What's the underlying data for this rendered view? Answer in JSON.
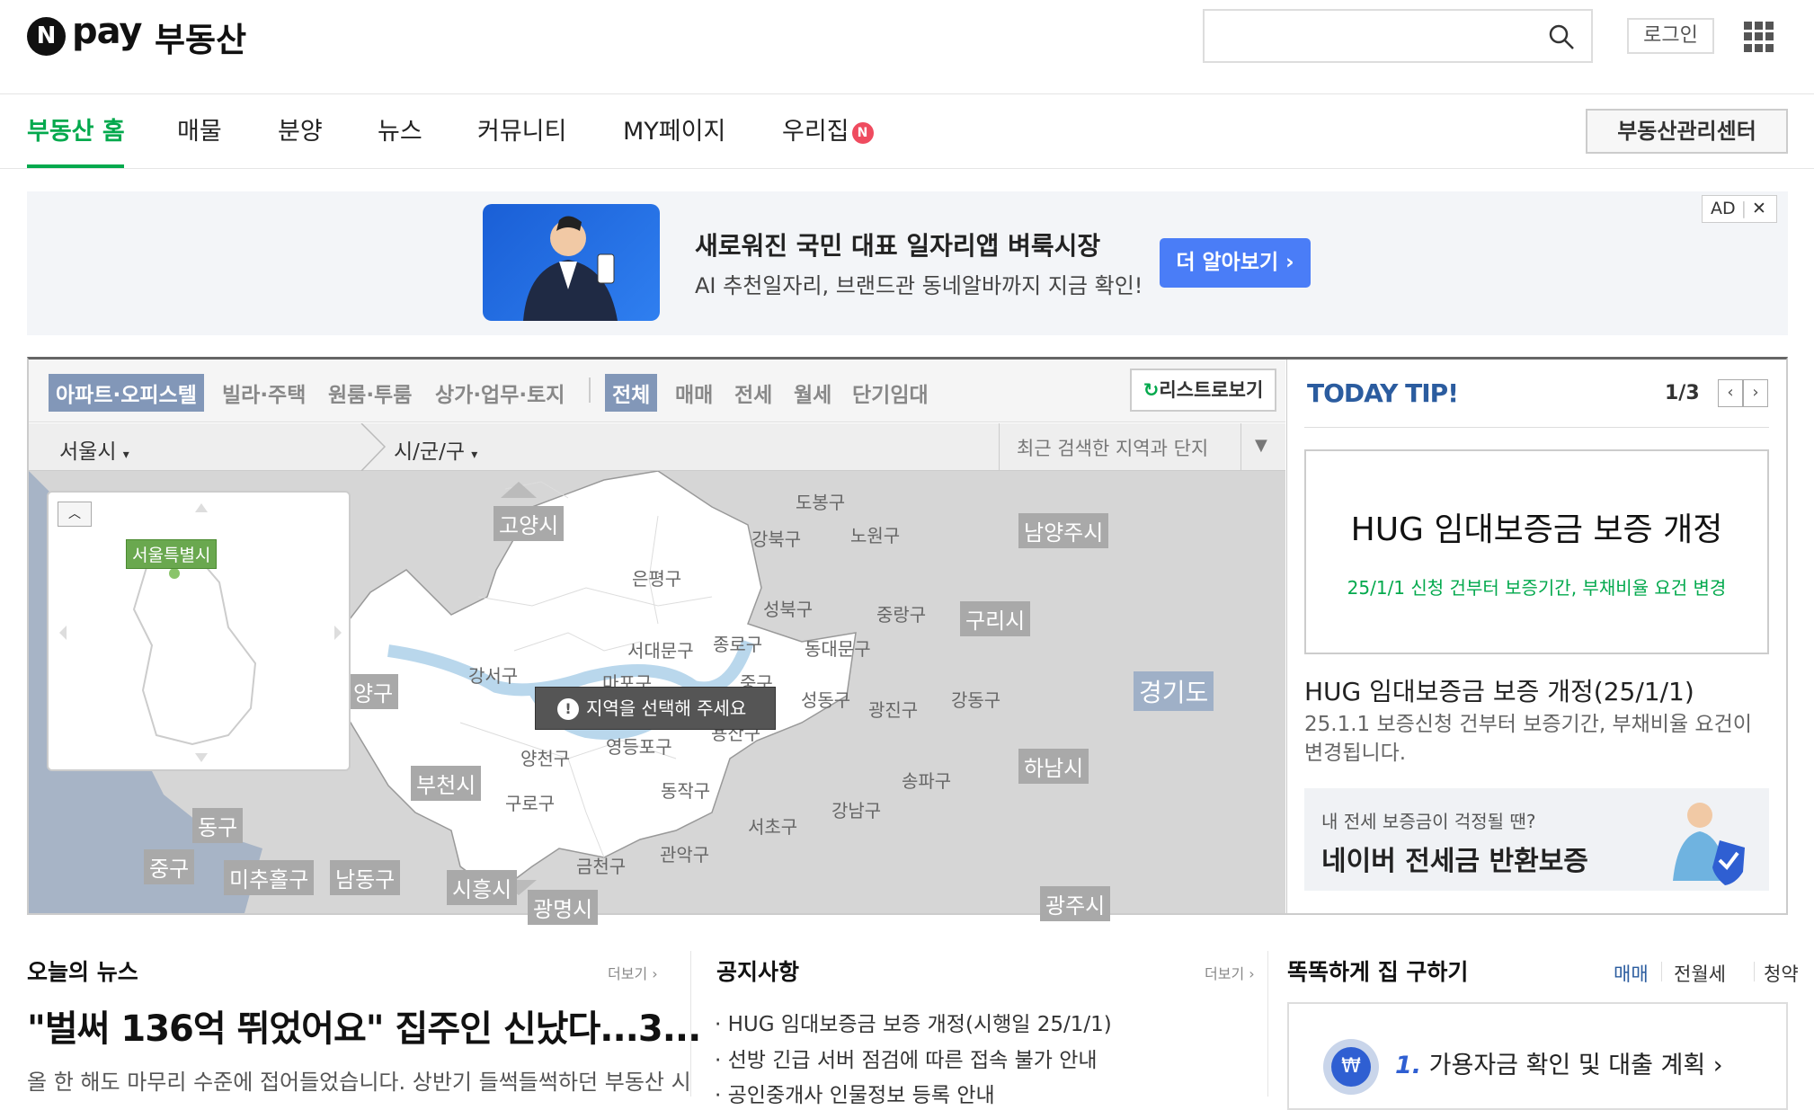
{
  "header": {
    "logo_n": "N",
    "logo_pay": "pay",
    "logo_title": "부동산",
    "search_placeholder": "",
    "login": "로그인"
  },
  "nav": {
    "items": [
      "부동산 홈",
      "매물",
      "분양",
      "뉴스",
      "커뮤니티",
      "MY페이지",
      "우리집"
    ],
    "badge": "N",
    "mgmt": "부동산관리센터"
  },
  "ad": {
    "title": "새로워진 국민 대표 일자리앱 벼룩시장",
    "sub": "AI 추천일자리, 브랜드관 동네알바까지 지금 확인!",
    "button": "더 알아보기 ›",
    "tag": "AD",
    "close": "✕"
  },
  "map": {
    "types": [
      "아파트·오피스텔",
      "빌라·주택",
      "원룸·투룸",
      "상가·업무·토지"
    ],
    "deals": [
      "전체",
      "매매",
      "전세",
      "월세",
      "단기임대"
    ],
    "list_button": "리스트로보기",
    "city": "서울시",
    "district": "시/군/구",
    "recent": "최근 검색한 지역과 단지",
    "mini_label": "서울특별시",
    "overlay": "지역을 선택해 주세요",
    "regions": [
      "고양시",
      "남양주시",
      "구리시",
      "경기도",
      "하남시",
      "부천시",
      "시흥시",
      "광명시",
      "광주시",
      "미추홀구",
      "남동구",
      "동구",
      "중구",
      "양구"
    ],
    "districts": [
      "도봉구",
      "강북구",
      "노원구",
      "은평구",
      "성북구",
      "중랑구",
      "서대문구",
      "종로구",
      "동대문구",
      "강서구",
      "마포구",
      "중구",
      "성동구",
      "광진구",
      "강동구",
      "용산구",
      "양천구",
      "영등포구",
      "구로구",
      "동작구",
      "서초구",
      "강남구",
      "송파구",
      "금천구",
      "관악구"
    ]
  },
  "tip": {
    "title": "TODAY TIP!",
    "page": "1/3",
    "card_title": "HUG 임대보증금 보증 개정",
    "card_sub": "25/1/1 신청 건부터 보증기간, 부채비율 요건 변경",
    "head": "HUG 임대보증금 보증 개정(25/1/1)",
    "desc": "25.1.1 보증신청 건부터 보증기간, 부채비율 요건이 변경됩니다.",
    "banner1": "내 전세 보증금이 걱정될 땐?",
    "banner2": "네이버 전세금 반환보증"
  },
  "news": {
    "title": "오늘의 뉴스",
    "more": "더보기 ›",
    "headline": "\"벌써 136억 뛰었어요\" 집주인 신났다...3...",
    "desc": "올 한 해도 마무리 수준에 접어들었습니다. 상반기 들썩들썩하던 부동산 시"
  },
  "notice": {
    "title": "공지사항",
    "more": "더보기 ›",
    "items": [
      "HUG 임대보증금 보증 개정(시행일 25/1/1)",
      "선방 긴급 서버 점검에 따른 접속 불가 안내",
      "공인중개사 인물정보 등록 안내"
    ]
  },
  "home": {
    "title": "똑똑하게 집 구하기",
    "tabs": [
      "매매",
      "전월세",
      "청약"
    ],
    "step_num": "1.",
    "step_text": "가용자금 확인 및 대출 계획 ›",
    "step_icon": "₩"
  }
}
